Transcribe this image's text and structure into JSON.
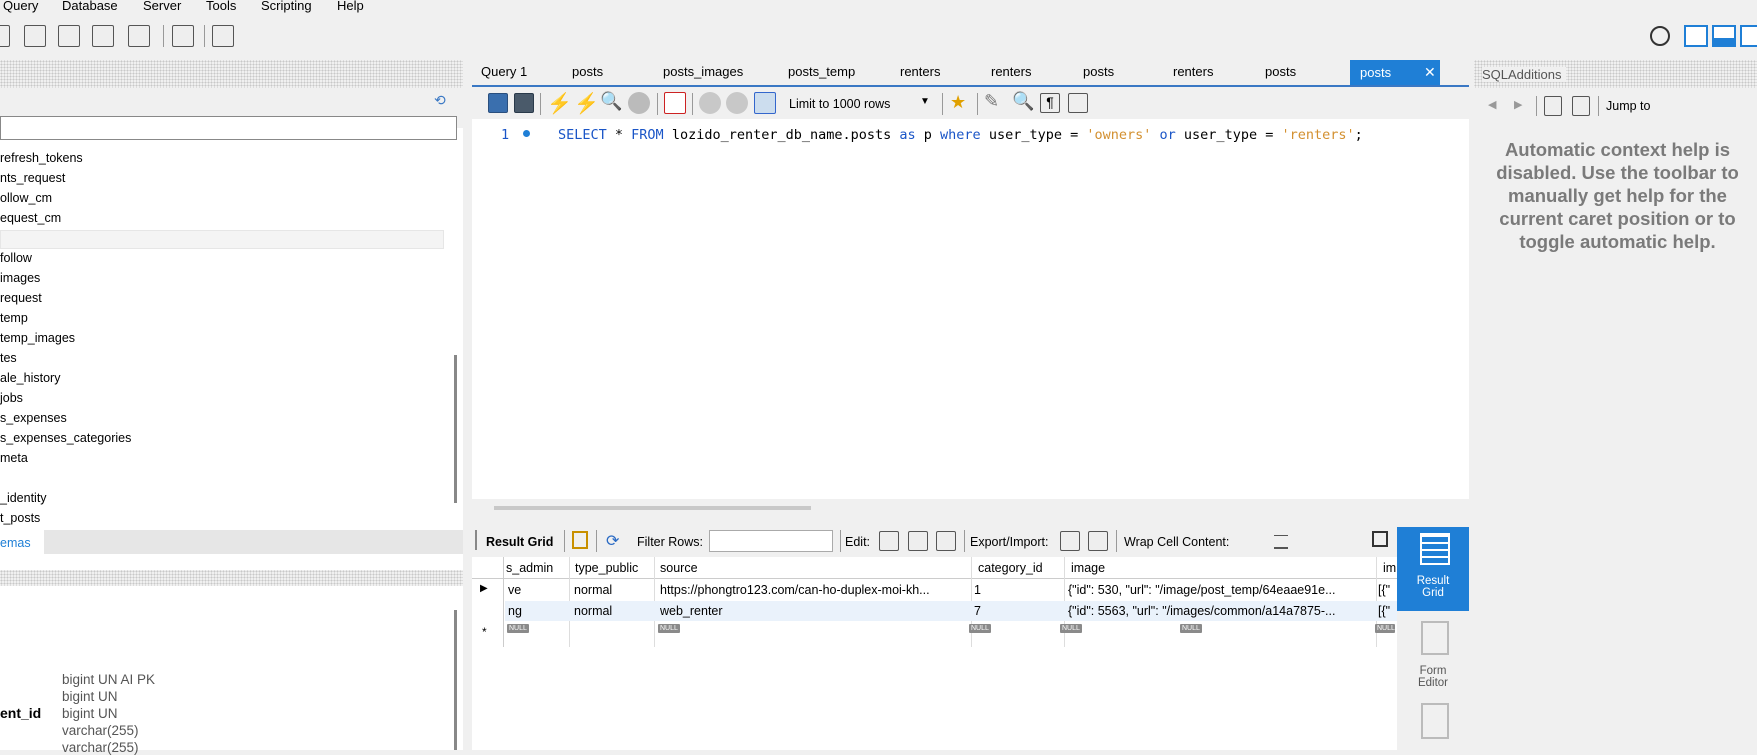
{
  "menu": [
    "Query",
    "Database",
    "Server",
    "Tools",
    "Scripting",
    "Help"
  ],
  "left_panel": {
    "tree_items": [
      "refresh_tokens",
      "nts_request",
      "ollow_cm",
      "equest_cm",
      "follow",
      "images",
      "request",
      "temp",
      "temp_images",
      "tes",
      "ale_history",
      "jobs",
      "s_expenses",
      "s_expenses_categories",
      "meta",
      "_identity",
      "t_posts"
    ],
    "schemas_tab": "emas",
    "columns": [
      {
        "name": "",
        "type": "bigint UN AI PK"
      },
      {
        "name": "",
        "type": "bigint UN"
      },
      {
        "name": "ent_id",
        "type": "bigint UN"
      },
      {
        "name": "",
        "type": "varchar(255)"
      },
      {
        "name": "",
        "type": "varchar(255)"
      }
    ]
  },
  "editor_tabs": [
    "Query 1",
    "posts",
    "posts_images",
    "posts_temp",
    "renters",
    "renters",
    "posts",
    "renters",
    "posts",
    "posts"
  ],
  "editor_toolbar": {
    "limit_label": "Limit to 1000 rows"
  },
  "sql": {
    "line_number": "1",
    "tokens": [
      {
        "t": "SELECT",
        "c": "kw"
      },
      {
        "t": " * ",
        "c": ""
      },
      {
        "t": "FROM",
        "c": "kw"
      },
      {
        "t": " lozido_renter_db_name.posts ",
        "c": ""
      },
      {
        "t": "as",
        "c": "kw"
      },
      {
        "t": " p ",
        "c": ""
      },
      {
        "t": "where",
        "c": "kw"
      },
      {
        "t": " user_type = ",
        "c": ""
      },
      {
        "t": "'owners'",
        "c": "str"
      },
      {
        "t": " ",
        "c": ""
      },
      {
        "t": "or",
        "c": "kw"
      },
      {
        "t": " user_type = ",
        "c": ""
      },
      {
        "t": "'renters'",
        "c": "str"
      },
      {
        "t": ";",
        "c": ""
      }
    ]
  },
  "result_toolbar": {
    "result_grid": "Result Grid",
    "filter_rows": "Filter Rows:",
    "edit": "Edit:",
    "export_import": "Export/Import:",
    "wrap": "Wrap Cell Content:"
  },
  "grid": {
    "headers": [
      "s_admin",
      "type_public",
      "source",
      "category_id",
      "image",
      "im"
    ],
    "rows": [
      [
        "ve",
        "normal",
        "https://phongtro123.com/can-ho-duplex-moi-kh...",
        "1",
        "{\"id\": 530, \"url\": \"/image/post_temp/64eaae91e...",
        "[{\""
      ],
      [
        "ng",
        "normal",
        "web_renter",
        "7",
        "{\"id\": 5563, \"url\": \"/images/common/a14a7875-...",
        "[{\""
      ]
    ],
    "null_label": "NULL"
  },
  "side_rail": {
    "result_grid": [
      "Result",
      "Grid"
    ],
    "form_editor": [
      "Form",
      "Editor"
    ]
  },
  "sql_additions": {
    "title": "SQLAdditions",
    "jump_to": "Jump to",
    "help_text": "Automatic context help is disabled. Use the toolbar to manually get help for the current caret position or to toggle automatic help."
  }
}
